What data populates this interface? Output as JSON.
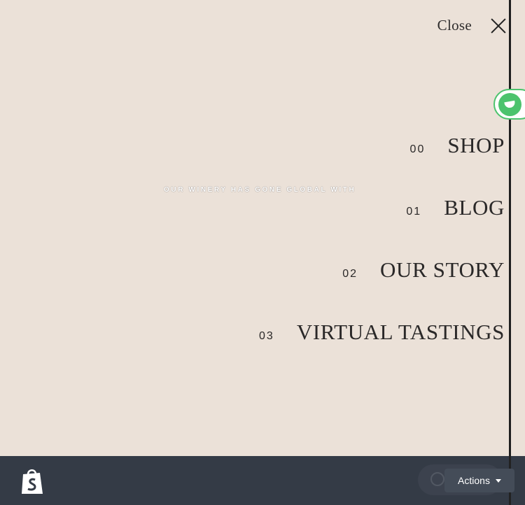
{
  "menu": {
    "close_label": "Close",
    "tagline": "OUR WINERY HAS GONE GLOBAL WITH",
    "items": [
      {
        "number": "00",
        "label": "SHOP"
      },
      {
        "number": "01",
        "label": "BLOG"
      },
      {
        "number": "02",
        "label": "OUR STORY"
      },
      {
        "number": "03",
        "label": "VIRTUAL TASTINGS"
      }
    ]
  },
  "footer": {
    "actions_label": "Actions"
  },
  "icons": {
    "close": "close-icon",
    "chat": "chat-icon",
    "shopify": "shopify-bag-icon",
    "caret": "chevron-down-icon"
  },
  "colors": {
    "background": "#ebe1d8",
    "text": "#2a2828",
    "chat_green": "#4cc36d",
    "footer_bar": "#343b46"
  }
}
